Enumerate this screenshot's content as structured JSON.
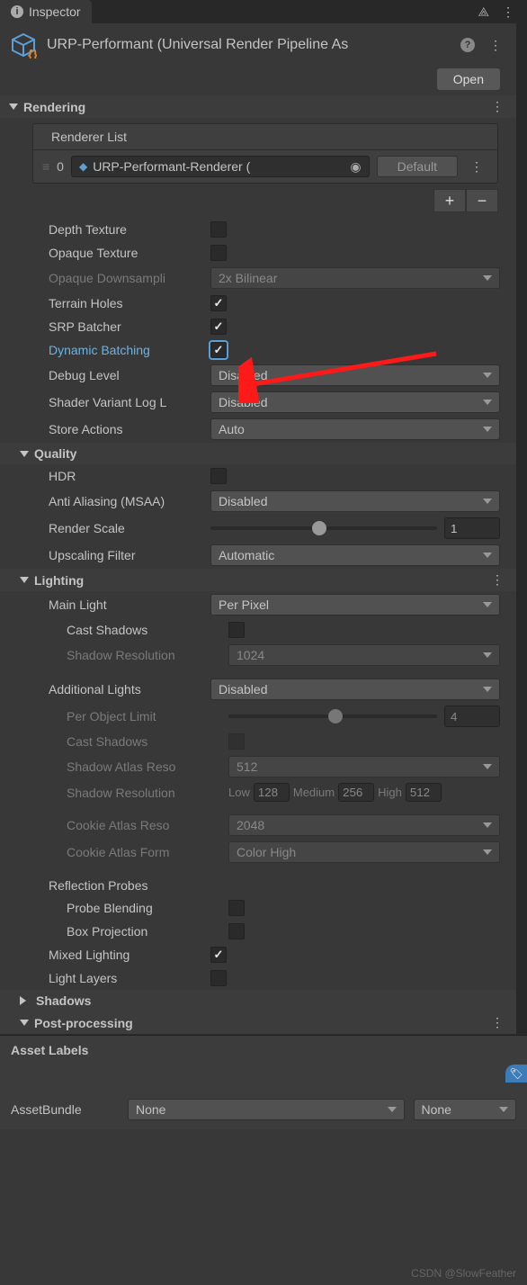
{
  "tab": {
    "title": "Inspector"
  },
  "asset": {
    "title": "URP-Performant (Universal Render Pipeline As",
    "open": "Open"
  },
  "rendering": {
    "title": "Rendering",
    "listTitle": "Renderer List",
    "item": {
      "index": "0",
      "name": "URP-Performant-Renderer (",
      "default": "Default"
    },
    "depthTexture": "Depth Texture",
    "opaqueTexture": "Opaque Texture",
    "opaqueDownsampling": "Opaque Downsampli",
    "opaqueDownsamplingVal": "2x Bilinear",
    "terrainHoles": "Terrain Holes",
    "srpBatcher": "SRP Batcher",
    "dynamicBatching": "Dynamic Batching",
    "debugLevel": "Debug Level",
    "debugLevelVal": "Disabled",
    "shaderVariant": "Shader Variant Log L",
    "shaderVariantVal": "Disabled",
    "storeActions": "Store Actions",
    "storeActionsVal": "Auto"
  },
  "quality": {
    "title": "Quality",
    "hdr": "HDR",
    "msaa": "Anti Aliasing (MSAA)",
    "msaaVal": "Disabled",
    "renderScale": "Render Scale",
    "renderScaleVal": "1",
    "upscaling": "Upscaling Filter",
    "upscalingVal": "Automatic"
  },
  "lighting": {
    "title": "Lighting",
    "mainLight": "Main Light",
    "mainLightVal": "Per Pixel",
    "castShadows": "Cast Shadows",
    "shadowRes": "Shadow Resolution",
    "shadowResVal": "1024",
    "addLights": "Additional Lights",
    "addLightsVal": "Disabled",
    "perObjLimit": "Per Object Limit",
    "perObjLimitVal": "4",
    "castShadows2": "Cast Shadows",
    "shadowAtlas": "Shadow Atlas Reso",
    "shadowAtlasVal": "512",
    "shadowResTiers": "Shadow Resolution",
    "low": "Low",
    "lowVal": "128",
    "med": "Medium",
    "medVal": "256",
    "high": "High",
    "highVal": "512",
    "cookieAtlasRes": "Cookie Atlas Reso",
    "cookieAtlasResVal": "2048",
    "cookieAtlasFmt": "Cookie Atlas Form",
    "cookieAtlasFmtVal": "Color High",
    "reflectionProbes": "Reflection Probes",
    "probeBlending": "Probe Blending",
    "boxProjection": "Box Projection",
    "mixedLighting": "Mixed Lighting",
    "lightLayers": "Light Layers"
  },
  "shadows": {
    "title": "Shadows"
  },
  "postproc": {
    "title": "Post-processing"
  },
  "assetLabels": "Asset Labels",
  "bundle": {
    "label": "AssetBundle",
    "val1": "None",
    "val2": "None"
  },
  "watermark": "CSDN @SlowFeather"
}
